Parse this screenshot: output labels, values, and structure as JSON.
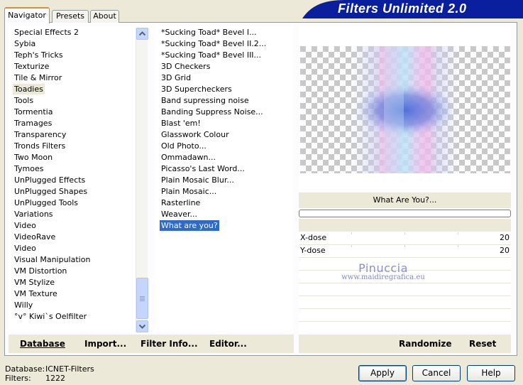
{
  "banner": {
    "title": "Filters Unlimited 2.0",
    "color": "#0a1f9e"
  },
  "tabs": [
    {
      "label": "Navigator",
      "active": true
    },
    {
      "label": "Presets",
      "active": false
    },
    {
      "label": "About",
      "active": false
    }
  ],
  "categories": [
    "Special Effects 2",
    "Sybia",
    "Teph's Tricks",
    "Texturize",
    "Tile & Mirror",
    "Toadies",
    "Tools",
    "Tormentia",
    "Tramages",
    "Transparency",
    "Tronds Filters",
    "Two Moon",
    "Tymoes",
    "UnPlugged Effects",
    "UnPlugged Shapes",
    "UnPlugged Tools",
    "Variations",
    "Video",
    "VideoRave",
    "Video",
    "Visual Manipulation",
    "VM Distortion",
    "VM Stylize",
    "VM Texture",
    "Willy",
    "°v° Kiwi`s Oelfilter"
  ],
  "selected_category": "Toadies",
  "filters": [
    "*Sucking Toad*  Bevel I...",
    "*Sucking Toad*  Bevel II.2...",
    "*Sucking Toad*  Bevel III...",
    "3D Checkers",
    "3D Grid",
    "3D Supercheckers",
    "Band supressing noise",
    "Banding Suppress Noise...",
    "Blast 'em!",
    "Glasswork Colour",
    "Old Photo...",
    "Ommadawn...",
    "Picasso's Last Word...",
    "Plain Mosaic Blur...",
    "Plain Mosaic...",
    "Rasterline",
    "Weaver...",
    "What are you?"
  ],
  "selected_filter": "What are you?",
  "preview": {
    "filter_name": "What Are You?...",
    "progress": 0
  },
  "params": [
    {
      "label": "X-dose",
      "value": "20"
    },
    {
      "label": "Y-dose",
      "value": "20"
    }
  ],
  "watermark": {
    "name": "Pinuccia",
    "site": "www.maidiregrafica.eu"
  },
  "commands_left": {
    "database": "Database",
    "import": "Import...",
    "filter_info": "Filter Info...",
    "editor": "Editor..."
  },
  "commands_right": {
    "randomize": "Randomize",
    "reset": "Reset"
  },
  "status": {
    "database_label": "Database:",
    "database_value": "ICNET-Filters",
    "filters_label": "Filters:",
    "filters_value": "1222"
  },
  "buttons": {
    "apply": "Apply",
    "cancel": "Cancel",
    "help": "Help"
  },
  "colors": {
    "selection": "#316ac5",
    "highlight": "#ece9d8",
    "tab_accent": "#e68b2c"
  }
}
